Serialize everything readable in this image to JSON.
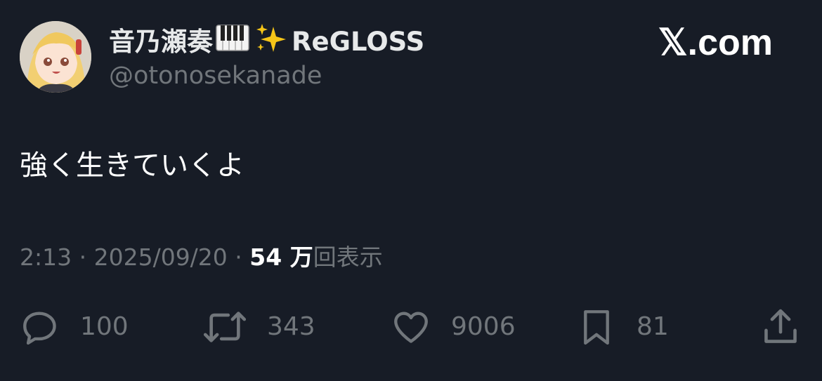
{
  "author": {
    "name_prefix": "音乃瀬奏",
    "name_emoji_1": "🎹",
    "name_emoji_2": "✨",
    "name_suffix": "ReGLOSS",
    "handle": "@otonosekanade",
    "avatar_icon": "avatar-image"
  },
  "brand": {
    "label": "𝕏.com"
  },
  "tweet": {
    "text": "強く生きていくよ"
  },
  "meta": {
    "time": "2:13",
    "sep1": " · ",
    "date": "2025/09/20",
    "sep2": " · ",
    "views_count": "54 万",
    "views_label": "回表示"
  },
  "actions": {
    "reply": {
      "icon": "reply-icon",
      "count": "100"
    },
    "retweet": {
      "icon": "retweet-icon",
      "count": "343"
    },
    "like": {
      "icon": "heart-icon",
      "count": "9006"
    },
    "bookmark": {
      "icon": "bookmark-icon",
      "count": "81"
    },
    "share": {
      "icon": "share-icon"
    }
  },
  "colors": {
    "background": "#171c26",
    "primary_text": "#e7e9ea",
    "secondary_text": "#71767b"
  }
}
